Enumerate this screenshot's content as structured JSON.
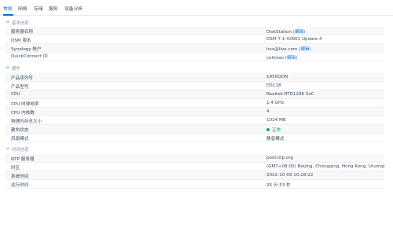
{
  "tabs": [
    "常规",
    "网络",
    "存储",
    "服务",
    "设备分析"
  ],
  "active_tab": 0,
  "sections": {
    "basic": "基本信息",
    "hardware": "硬件",
    "time": "时间信息"
  },
  "rows": {
    "server_name": {
      "label": "服务器名称",
      "value": "DiskStation",
      "link": "(编辑)"
    },
    "dsm_version": {
      "label": "DSM 版本",
      "value": "DSM 7.1-42661 Update 4"
    },
    "synology_account": {
      "label": "Synology 帐户",
      "value": "hxx@live.com",
      "link": "(编辑)"
    },
    "quickconnect": {
      "label": "QuickConnect ID",
      "value": "celmiao",
      "link": "(编辑)"
    },
    "serial": {
      "label": "产品序列号",
      "value": "1950QDN"
    },
    "model": {
      "label": "产品型号",
      "value": "DS118"
    },
    "cpu": {
      "label": "CPU",
      "value": "Realtek RTD1296 SoC"
    },
    "cpu_freq": {
      "label": "CPU 时钟频率",
      "value": "1.4 GHz"
    },
    "cpu_cores": {
      "label": "CPU 内核数",
      "value": "4"
    },
    "memory": {
      "label": "物理内存总大小",
      "value": "1024 MB"
    },
    "thermal": {
      "label": "散热状态",
      "value": "正常",
      "status_color": "#1da553"
    },
    "fan": {
      "label": "风扇模式",
      "value": "静音模式"
    },
    "ntp": {
      "label": "NTP 服务器",
      "value": "pool.ntp.org"
    },
    "timezone": {
      "label": "时区",
      "value": "(GMT+08:00) Beijing, Chongqing, Hong Kong, Urumqi"
    },
    "system_time": {
      "label": "系统时间",
      "value": "2022-10-09 10:28:22"
    },
    "uptime": {
      "label": "运行时间",
      "value": "25 分 53 秒"
    }
  },
  "colors": {
    "accent": "#0b6fdc",
    "ok": "#1da553"
  }
}
